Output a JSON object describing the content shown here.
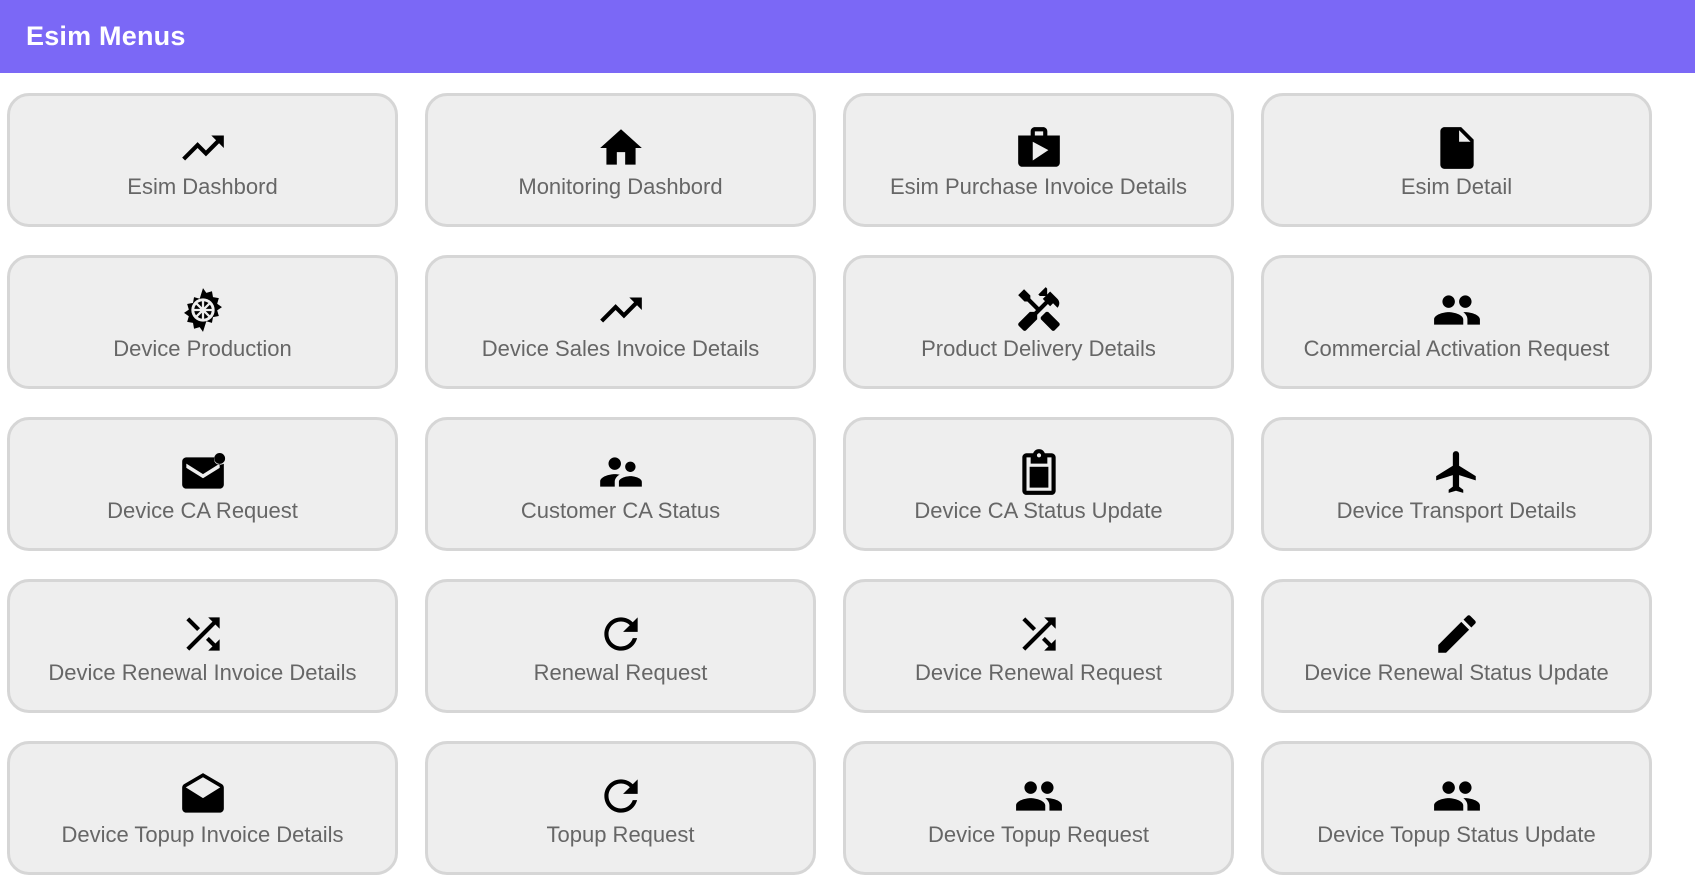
{
  "header": {
    "title": "Esim Menus",
    "background_color": "#7b68f6"
  },
  "menu": {
    "items": [
      {
        "label": "Esim Dashbord",
        "icon": "trending-up-icon"
      },
      {
        "label": "Monitoring Dashbord",
        "icon": "home-icon"
      },
      {
        "label": "Esim Purchase Invoice Details",
        "icon": "shop-bag-icon"
      },
      {
        "label": "Esim Detail",
        "icon": "file-icon"
      },
      {
        "label": "Device Production",
        "icon": "gear-icon"
      },
      {
        "label": "Device Sales Invoice Details",
        "icon": "trending-up-icon"
      },
      {
        "label": "Product Delivery Details",
        "icon": "tools-icon"
      },
      {
        "label": "Commercial Activation Request",
        "icon": "people-icon"
      },
      {
        "label": "Device CA Request",
        "icon": "mail-unread-icon"
      },
      {
        "label": "Customer CA Status",
        "icon": "supervisor-icon"
      },
      {
        "label": "Device CA Status Update",
        "icon": "clipboard-icon"
      },
      {
        "label": "Device Transport Details",
        "icon": "airplane-icon"
      },
      {
        "label": "Device Renewal Invoice Details",
        "icon": "shuffle-icon"
      },
      {
        "label": "Renewal Request",
        "icon": "refresh-icon"
      },
      {
        "label": "Device Renewal Request",
        "icon": "shuffle-icon"
      },
      {
        "label": "Device Renewal Status Update",
        "icon": "pencil-icon"
      },
      {
        "label": "Device Topup Invoice Details",
        "icon": "mail-open-icon"
      },
      {
        "label": "Topup Request",
        "icon": "refresh-icon"
      },
      {
        "label": "Device Topup Request",
        "icon": "people-icon"
      },
      {
        "label": "Device Topup Status Update",
        "icon": "people-icon"
      }
    ]
  }
}
